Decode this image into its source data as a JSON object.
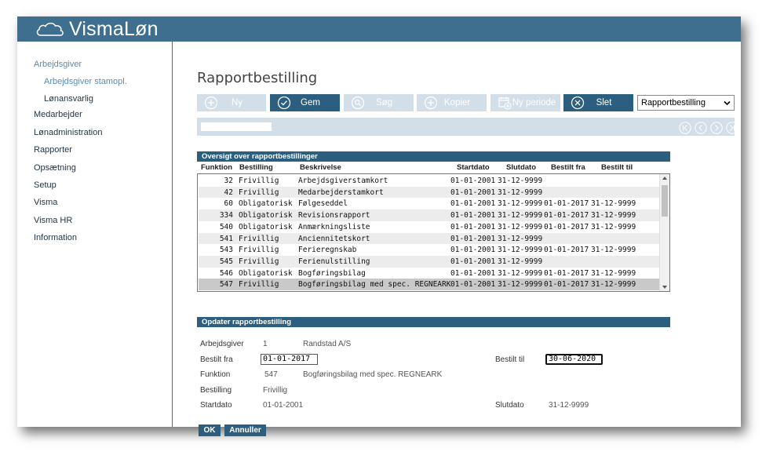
{
  "app": {
    "brand": "VismaLøn"
  },
  "sidebar": {
    "items": [
      {
        "label": "Arbejdsgiver",
        "active": true
      },
      {
        "label": "Arbejdsgiver stamopl.",
        "active": true,
        "sub": true
      },
      {
        "label": "Lønansvarlig",
        "sub": true
      },
      {
        "label": "Medarbejder"
      },
      {
        "label": "Lønadministration"
      },
      {
        "label": "Rapporter"
      },
      {
        "label": "Opsætning"
      },
      {
        "label": "Setup"
      },
      {
        "label": "Visma"
      },
      {
        "label": "Visma HR"
      },
      {
        "label": "Information"
      }
    ]
  },
  "page": {
    "title": "Rapportbestilling"
  },
  "toolbar": {
    "ny": "Ny",
    "gem": "Gem",
    "sog": "Søg",
    "kopier": "Kopier",
    "ny_periode": "Ny periode",
    "slet": "Slet",
    "select_value": "Rapportbestilling"
  },
  "overview": {
    "title": "Oversigt over rapportbestillinger",
    "headers": [
      "Funktion",
      "Bestilling",
      "Beskrivelse",
      "Startdato",
      "Slutdato",
      "Bestilt fra",
      "Bestilt til"
    ],
    "rows": [
      [
        "32",
        "Frivillig",
        "Arbejdsgiverstamkort",
        "01-01-2001",
        "31-12-9999",
        "",
        ""
      ],
      [
        "42",
        "Frivillig",
        "Medarbejderstamkort",
        "01-01-2001",
        "31-12-9999",
        "",
        ""
      ],
      [
        "60",
        "Obligatorisk",
        "Følgeseddel",
        "01-01-2001",
        "31-12-9999",
        "01-01-2017",
        "31-12-9999"
      ],
      [
        "334",
        "Obligatorisk",
        "Revisionsrapport",
        "01-01-2001",
        "31-12-9999",
        "01-01-2017",
        "31-12-9999"
      ],
      [
        "540",
        "Obligatorisk",
        "Anmærkningsliste",
        "01-01-2001",
        "31-12-9999",
        "01-01-2017",
        "31-12-9999"
      ],
      [
        "541",
        "Frivillig",
        "Anciennitetskort",
        "01-01-2001",
        "31-12-9999",
        "",
        ""
      ],
      [
        "543",
        "Frivillig",
        "Ferieregnskab",
        "01-01-2001",
        "31-12-9999",
        "01-01-2017",
        "31-12-9999"
      ],
      [
        "545",
        "Frivillig",
        "Ferienulstilling",
        "01-01-2001",
        "31-12-9999",
        "",
        ""
      ],
      [
        "546",
        "Obligatorisk",
        "Bogføringsbilag",
        "01-01-2001",
        "31-12-9999",
        "01-01-2017",
        "31-12-9999"
      ],
      [
        "547",
        "Frivillig",
        "Bogføringsbilag med spec. REGNEARK",
        "01-01-2001",
        "31-12-9999",
        "01-01-2017",
        "31-12-9999"
      ]
    ]
  },
  "update": {
    "title": "Opdater rapportbestilling",
    "arbejdsgiver_label": "Arbejdsgiver",
    "arbejdsgiver_nr": "1",
    "arbejdsgiver_navn": "Randstad A/S",
    "bestilt_fra_label": "Bestilt fra",
    "bestilt_fra_value": "01-01-2017",
    "bestilt_til_label": "Bestilt til",
    "bestilt_til_value": "30-06-2020",
    "funktion_label": "Funktion",
    "funktion_nr": "547",
    "funktion_navn": "Bogføringsbilag med spec. REGNEARK",
    "bestilling_label": "Bestilling",
    "bestilling_value": "Frivillig",
    "startdato_label": "Startdato",
    "startdato_value": "01-01-2001",
    "slutdato_label": "Slutdato",
    "slutdato_value": "31-12-9999"
  },
  "actions": {
    "ok": "OK",
    "annuller": "Annuller"
  },
  "colors": {
    "brand": "#3f6f8f",
    "button": "#2c5f7f",
    "disabled": "#d3dfe8"
  }
}
